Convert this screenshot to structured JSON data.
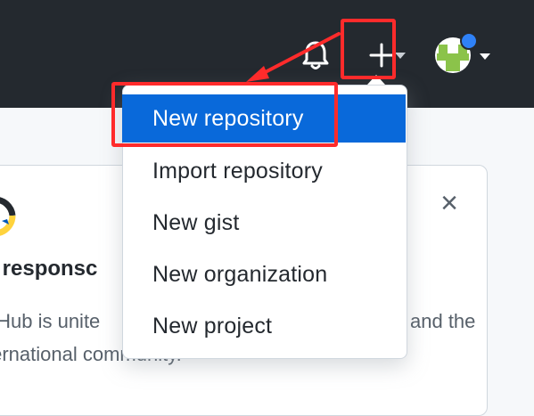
{
  "header": {
    "icons": [
      "bell-icon",
      "plus-icon",
      "caret-down-icon",
      "avatar"
    ]
  },
  "menu": {
    "items": [
      {
        "label": "New repository",
        "active": true
      },
      {
        "label": "Import repository",
        "active": false
      },
      {
        "label": "New gist",
        "active": false
      },
      {
        "label": "New organization",
        "active": false
      },
      {
        "label": "New project",
        "active": false
      }
    ]
  },
  "card": {
    "title_fragment": "ur responsc",
    "text_line1": "tHub is unite",
    "text_line1_end": "and the",
    "text_line2": "ternational community."
  },
  "colors": {
    "header_bg": "#24292f",
    "menu_active": "#0969da",
    "annotation": "#ff2b2b"
  }
}
